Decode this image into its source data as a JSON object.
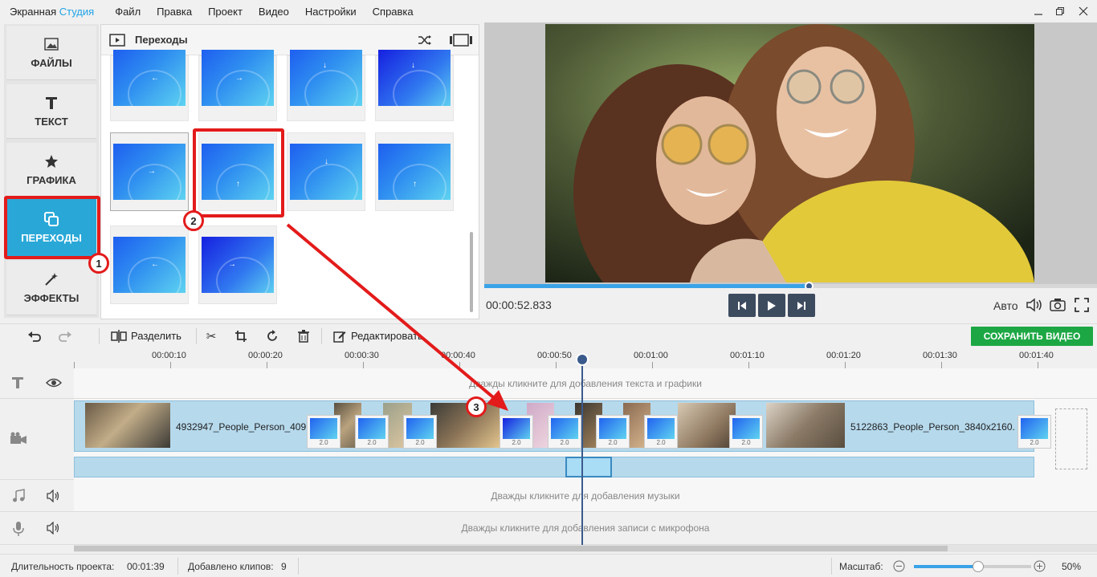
{
  "app": {
    "title_main": "Экранная ",
    "title_accent": "Студия"
  },
  "menu": [
    "Файл",
    "Правка",
    "Проект",
    "Видео",
    "Настройки",
    "Справка"
  ],
  "left_tabs": [
    {
      "label": "ФАЙЛЫ",
      "icon": "image-icon"
    },
    {
      "label": "ТЕКСТ",
      "icon": "text-icon"
    },
    {
      "label": "ГРАФИКА",
      "icon": "star-icon"
    },
    {
      "label": "ПЕРЕХОДЫ",
      "icon": "transitions-icon"
    },
    {
      "label": "ЭФФЕКТЫ",
      "icon": "magic-wand-icon"
    }
  ],
  "transitions_panel": {
    "title": "Переходы"
  },
  "player": {
    "timecode": "00:00:52.833",
    "progress": 0.53,
    "quality": "Авто"
  },
  "toolbar": {
    "split": "Разделить",
    "edit": "Редактировать",
    "save": "СОХРАНИТЬ ВИДЕО"
  },
  "ruler": [
    "00:00:10",
    "00:00:20",
    "00:00:30",
    "00:00:40",
    "00:00:50",
    "00:01:00",
    "00:01:10",
    "00:01:20",
    "00:01:30",
    "00:01:40"
  ],
  "tracks": {
    "text_hint": "Дважды кликните для добавления текста и графики",
    "music_hint": "Дважды кликните для добавления музыки",
    "mic_hint": "Дважды кликните для добавления записи с микрофона"
  },
  "clips": {
    "first_label": "4932947_People_Person_409",
    "last_label": "5122863_People_Person_3840x2160.",
    "transition_duration": "2.0"
  },
  "status": {
    "duration_label": "Длительность проекта:",
    "duration": "00:01:39",
    "clips_label": "Добавлено клипов:",
    "clips_count": "9",
    "zoom_label": "Масштаб:",
    "zoom": "50%"
  },
  "annotations": [
    "1",
    "2",
    "3"
  ],
  "colors": {
    "accent": "#29a8d8",
    "save": "#1da744",
    "annotation": "#e31b1b",
    "playhead": "#3a5a8c"
  }
}
